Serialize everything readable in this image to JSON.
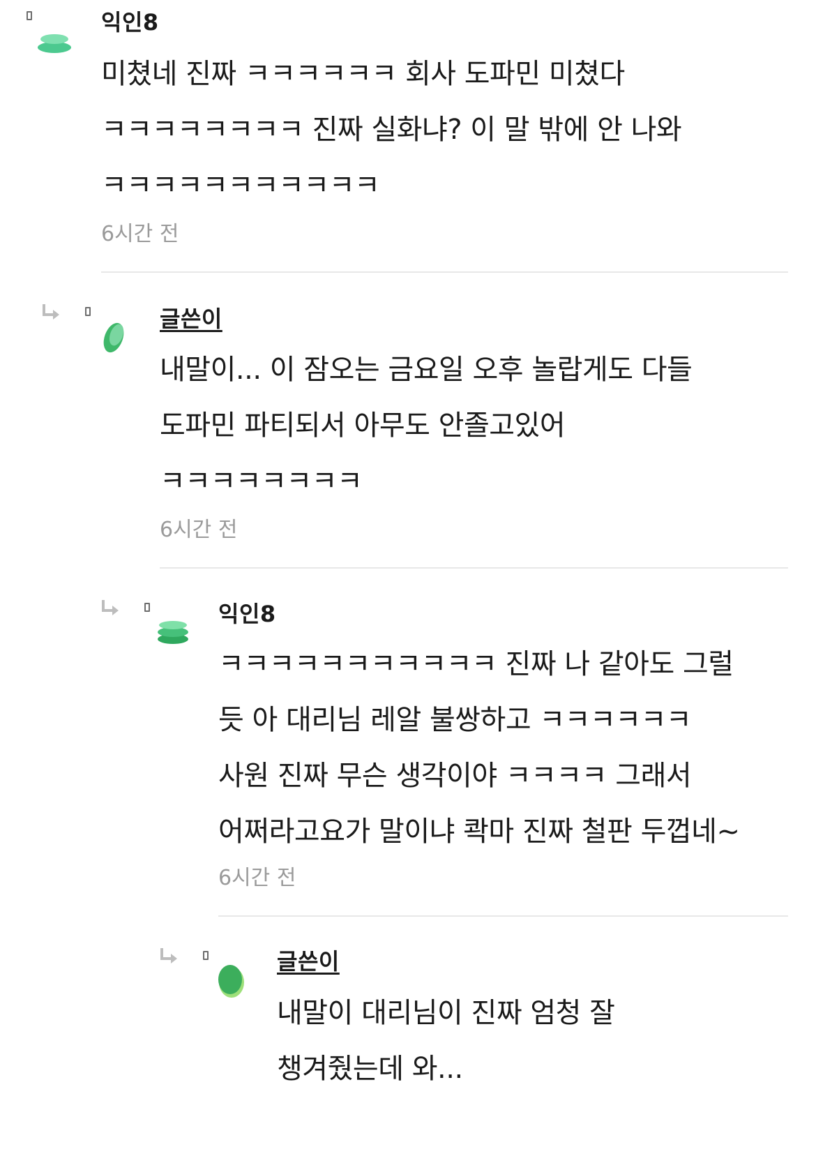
{
  "comments": [
    {
      "author": "익인8",
      "text": "미쳤네 진짜 ㅋㅋㅋㅋㅋㅋ 회사 도파민 미쳤다 ㅋㅋㅋㅋㅋㅋㅋㅋ 진짜 실화냐? 이 말 밖에 안 나와 ㅋㅋㅋㅋㅋㅋㅋㅋㅋㅋㅋ",
      "time": "6시간 전",
      "avatar_color": "#4cc98f"
    },
    {
      "author": "글쓴이",
      "text": "내말이... 이 잠오는 금요일 오후 놀랍게도 다들 도파민 파티되서 아무도 안졸고있어 ㅋㅋㅋㅋㅋㅋㅋㅋ",
      "time": "6시간 전",
      "avatar_color": "#3fb86a"
    },
    {
      "author": "익인8",
      "text": "ㅋㅋㅋㅋㅋㅋㅋㅋㅋㅋㅋ 진짜 나 같아도 그럴 듯 아 대리님 레알 불쌍하고 ㅋㅋㅋㅋㅋㅋ 사원 진짜 무슨 생각이야 ㅋㅋㅋㅋ 그래서 어쩌라고요가 말이냐 콱마 진짜 철판 두껍네~",
      "time": "6시간 전",
      "avatar_color": "#46c07a"
    },
    {
      "author": "글쓴이",
      "text": "내말이 대리님이 진짜 엄청 잘 챙겨줬는데 와...",
      "time": "",
      "avatar_color": "#3cae5c"
    }
  ],
  "icons": {
    "reply": "reply-arrow-icon",
    "marker": "small-marker-icon"
  },
  "colors": {
    "text": "#1a1a1a",
    "timestamp": "#9a9a9a",
    "divider": "#e8e8e8",
    "icon_gray": "#bdbdbd"
  }
}
